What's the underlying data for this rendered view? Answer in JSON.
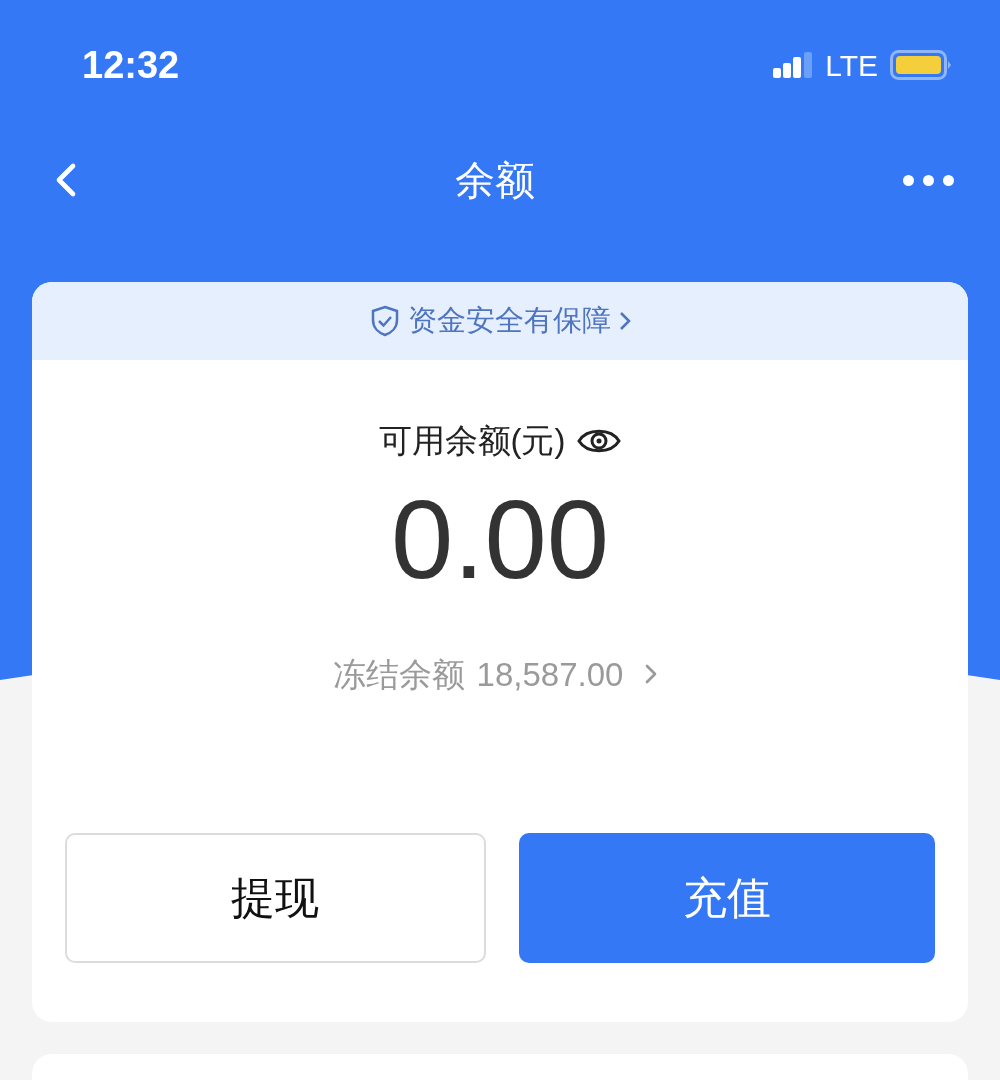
{
  "status_bar": {
    "time": "12:32",
    "network": "LTE"
  },
  "nav": {
    "title": "余额"
  },
  "card": {
    "banner": "资金安全有保障",
    "balance_label": "可用余额(元)",
    "balance": "0.00",
    "frozen_label": "冻结余额",
    "frozen_amount": "18,587.00"
  },
  "buttons": [
    {
      "label": "提现",
      "kind": "secondary"
    },
    {
      "label": "充值",
      "kind": "primary"
    }
  ]
}
